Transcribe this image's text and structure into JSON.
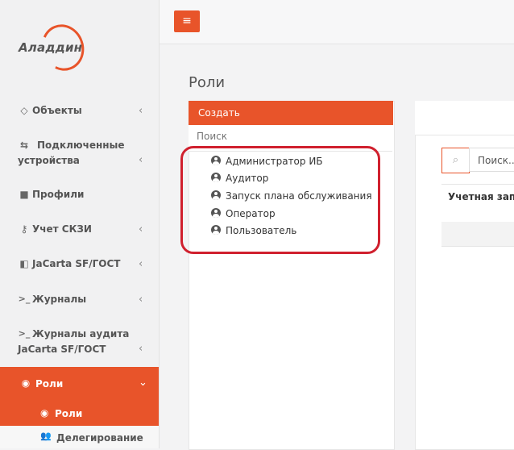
{
  "brand": {
    "logo_text": "Аладдин",
    "accent": "#e8542a",
    "highlight": "#d0202e"
  },
  "sidebar": {
    "items": [
      {
        "icon": "diamond-icon",
        "glyph": "◇",
        "label": "Объекты",
        "chevron": "‹"
      },
      {
        "icon": "usb-icon",
        "glyph": "⇆",
        "label_line1": "Подключенные",
        "label_line2": "устройства",
        "chevron": "‹"
      },
      {
        "icon": "folder-icon",
        "glyph": "■",
        "label": "Профили"
      },
      {
        "icon": "key-icon",
        "glyph": "⚷",
        "label": "Учет СКЗИ",
        "chevron": "‹"
      },
      {
        "icon": "shield-icon",
        "glyph": "◧",
        "label": "JaCarta SF/ГОСТ",
        "chevron": "‹"
      },
      {
        "icon": "terminal-icon",
        "glyph": ">_",
        "label": "Журналы",
        "chevron": "‹"
      },
      {
        "icon": "terminal-icon",
        "glyph": ">_",
        "label_line1": "Журналы аудита",
        "label_line2": "JaCarta SF/ГОСТ",
        "chevron": "‹"
      },
      {
        "icon": "user-circle-icon",
        "glyph": "◉",
        "label": "Роли",
        "chevron": "⌄"
      }
    ],
    "sub_items": [
      {
        "icon": "user-circle-icon",
        "glyph": "◉",
        "label": "Роли"
      },
      {
        "icon": "user-plus-icon",
        "glyph": "👥",
        "label": "Делегирование"
      }
    ]
  },
  "topbar": {
    "menu_glyph": "≡"
  },
  "main": {
    "title": "Роли",
    "create_label": "Создать",
    "search_placeholder": "Поиск",
    "roles": [
      "Администратор ИБ",
      "Аудитор",
      "Запуск плана обслуживания",
      "Оператор",
      "Пользователь"
    ]
  },
  "right": {
    "search_glyph": "⌕",
    "search_placeholder": "Поиск...",
    "table_header": "Учетная запись"
  }
}
